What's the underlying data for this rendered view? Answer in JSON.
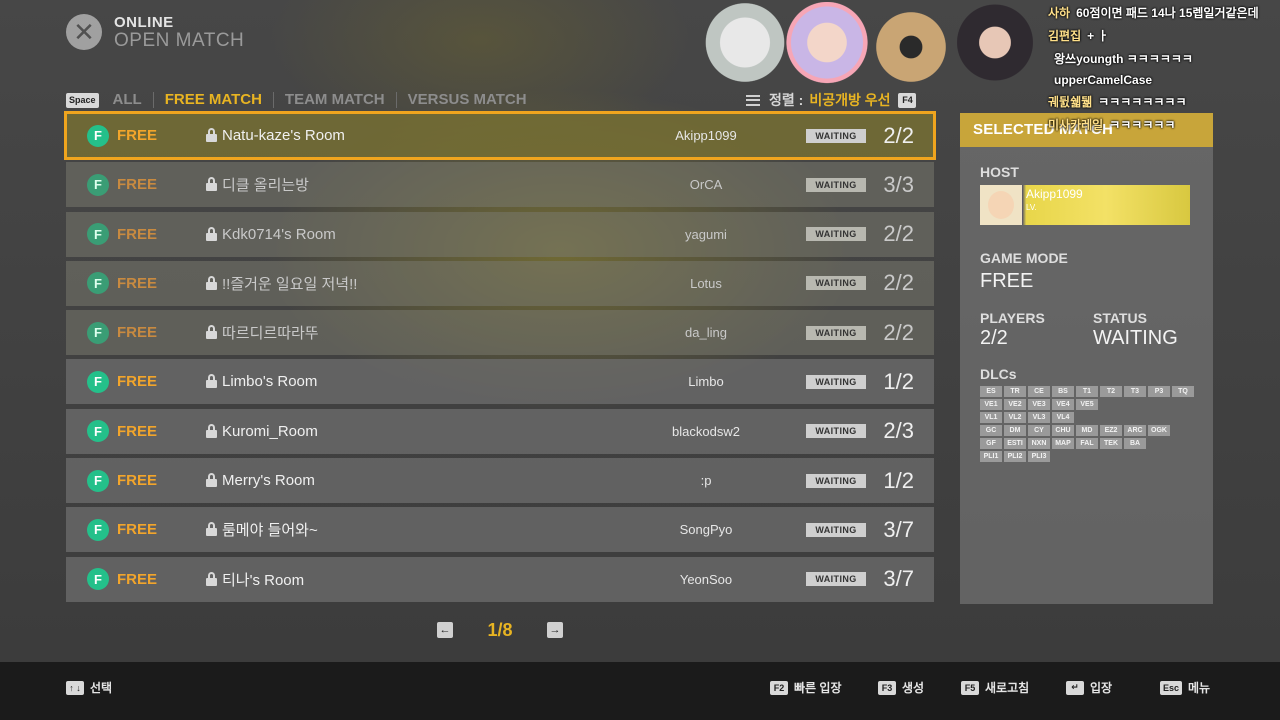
{
  "header": {
    "line1": "ONLINE",
    "line2": "OPEN MATCH"
  },
  "tabs": {
    "key": "Space",
    "items": [
      {
        "label": "ALL",
        "active": false
      },
      {
        "label": "FREE MATCH",
        "active": true
      },
      {
        "label": "TEAM MATCH",
        "active": false
      },
      {
        "label": "VERSUS MATCH",
        "active": false
      }
    ]
  },
  "sort": {
    "label": "정렬 :",
    "value": "비공개방 우선",
    "key": "F4"
  },
  "matches": [
    {
      "mode_letter": "F",
      "mode": "FREE",
      "name": "Natu-kaze's Room",
      "host": "Akipp1099",
      "status": "WAITING",
      "players": "2/2",
      "selected": true,
      "dim": false
    },
    {
      "mode_letter": "F",
      "mode": "FREE",
      "name": "디클 올리는방",
      "host": "OrCA",
      "status": "WAITING",
      "players": "3/3",
      "selected": false,
      "dim": true
    },
    {
      "mode_letter": "F",
      "mode": "FREE",
      "name": "Kdk0714's Room",
      "host": "yagumi",
      "status": "WAITING",
      "players": "2/2",
      "selected": false,
      "dim": true
    },
    {
      "mode_letter": "F",
      "mode": "FREE",
      "name": "!!즐거운 일요일 저녁!!",
      "host": "Lotus",
      "status": "WAITING",
      "players": "2/2",
      "selected": false,
      "dim": true
    },
    {
      "mode_letter": "F",
      "mode": "FREE",
      "name": "따르디르따라뚜",
      "host": "da_ling",
      "status": "WAITING",
      "players": "2/2",
      "selected": false,
      "dim": true
    },
    {
      "mode_letter": "F",
      "mode": "FREE",
      "name": "Limbo's Room",
      "host": "Limbo",
      "status": "WAITING",
      "players": "1/2",
      "selected": false,
      "dim": false
    },
    {
      "mode_letter": "F",
      "mode": "FREE",
      "name": "Kuromi_Room",
      "host": "blackodsw2",
      "status": "WAITING",
      "players": "2/3",
      "selected": false,
      "dim": false
    },
    {
      "mode_letter": "F",
      "mode": "FREE",
      "name": "Merry's Room",
      "host": ":p",
      "status": "WAITING",
      "players": "1/2",
      "selected": false,
      "dim": false
    },
    {
      "mode_letter": "F",
      "mode": "FREE",
      "name": "룸메야 들어와~",
      "host": "SongPyo",
      "status": "WAITING",
      "players": "3/7",
      "selected": false,
      "dim": false
    },
    {
      "mode_letter": "F",
      "mode": "FREE",
      "name": "티나's Room",
      "host": "YeonSoo",
      "status": "WAITING",
      "players": "3/7",
      "selected": false,
      "dim": false
    }
  ],
  "pager": {
    "prev": "←",
    "next": "→",
    "page": "1/8"
  },
  "panel": {
    "title": "SELECTED MATCH",
    "host_label": "HOST",
    "host_name": "Akipp1099",
    "host_lv": "LV.",
    "mode_label": "GAME MODE",
    "mode_value": "FREE",
    "players_label": "PLAYERS",
    "players_value": "2/2",
    "status_label": "STATUS",
    "status_value": "WAITING",
    "dlc_label": "DLCs",
    "dlc_rows": [
      [
        "ES",
        "TR",
        "CE",
        "BS",
        "T1",
        "T2",
        "T3",
        "P3",
        "TQ"
      ],
      [
        "VE1",
        "VE2",
        "VE3",
        "VE4",
        "VE5"
      ],
      [
        "VL1",
        "VL2",
        "VL3",
        "VL4"
      ],
      [
        "GC",
        "DM",
        "CY",
        "CHU",
        "MD",
        "EZ2",
        "ARC",
        "OGK"
      ],
      [
        "GF",
        "ESTI",
        "NXN",
        "MAP",
        "FAL",
        "TEK",
        "BA"
      ],
      [
        "PLI1",
        "PLI2",
        "PLI3"
      ]
    ]
  },
  "footer": {
    "hints": [
      {
        "key": "↑ ↓",
        "label": "선택"
      },
      {
        "key": "F2",
        "label": "빠른 입장"
      },
      {
        "key": "F3",
        "label": "생성"
      },
      {
        "key": "F5",
        "label": "새로고침"
      },
      {
        "key": "↵",
        "label": "입장"
      },
      {
        "key": "Esc",
        "label": "메뉴"
      }
    ]
  },
  "chat": [
    {
      "user": "사하",
      "msg": "60점이면 패드 14나 15렙일거같은데"
    },
    {
      "user": "김편집",
      "msg": "+ ㅏ "
    },
    {
      "user": "",
      "msg": "왕쓰youngth ㅋㅋㅋㅋㅋㅋ"
    },
    {
      "user": "",
      "msg": "upperCamelCase"
    },
    {
      "user": "궤뒰쉛뒒",
      "msg": "ㅋㅋㅋㅋㅋㅋㅋㅋ"
    },
    {
      "user": "미사카레일",
      "msg": "ㅋㅋㅋㅋㅋㅋ"
    }
  ],
  "colors": {
    "accent": "#e8b422",
    "selected_outline": "#f0a51e",
    "mode_badge": "#24c08a",
    "panel_header": "#c8a53a"
  }
}
